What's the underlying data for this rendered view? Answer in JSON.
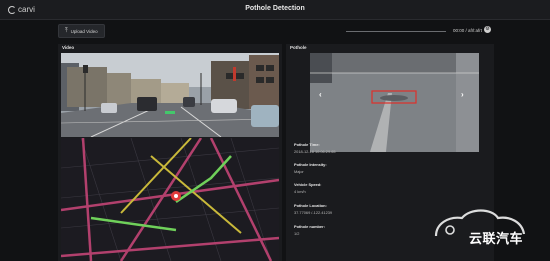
{
  "app": {
    "logo_text": "carvi",
    "title": "Pothole Detection"
  },
  "toolbar": {
    "upload_label": "Upload Video",
    "playback_progress": 0.0,
    "time_display": "00:00 / afrl:afrt"
  },
  "video_panel": {
    "label": "Video"
  },
  "pothole_panel": {
    "label": "Pothole",
    "arrow_left": "‹",
    "arrow_right": "›",
    "fields": [
      {
        "label": "Pothole Time:",
        "value": "2018-12-18 10:06:29.65"
      },
      {
        "label": "Pothole Intensity:",
        "value": "Major"
      },
      {
        "label": "Vehicle Speed:",
        "value": "4 km/h"
      },
      {
        "label": "Pothole Location:",
        "value": "37.77069 /-122.41239"
      },
      {
        "label": "Pothole number:",
        "value": "1/2"
      }
    ]
  },
  "watermark": {
    "text": "云联汽车"
  },
  "colors": {
    "background": "#111214",
    "panel": "#1a1b1e",
    "detection_box": "#e0302a",
    "map_road_pink": "#b2406d",
    "map_road_yellow": "#c9b93a",
    "map_road_green": "#6fd05a",
    "map_marker": "#e13b3b"
  }
}
